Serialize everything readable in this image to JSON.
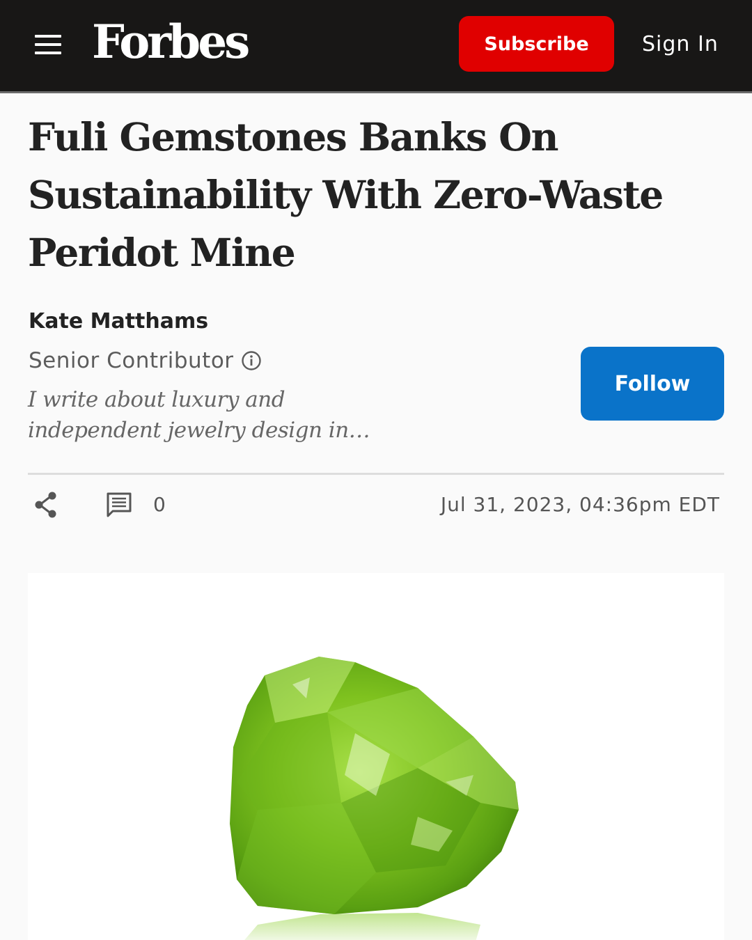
{
  "header": {
    "logo": "Forbes",
    "subscribe_label": "Subscribe",
    "signin_label": "Sign In",
    "menu_icon": "hamburger-menu-icon",
    "background_color": "#181716",
    "subscribe_color": "#e00000"
  },
  "article": {
    "title": "Fuli Gemstones Banks On Sustainability With Zero-Waste Peridot Mine",
    "author": {
      "name": "Kate Matthams",
      "role": "Senior Contributor",
      "bio": "I write about luxury and independent jewelry design in…",
      "info_icon": "info-icon",
      "follow_label": "Follow",
      "follow_color": "#0a73c9"
    },
    "meta": {
      "share_icon": "share-icon",
      "comment_icon": "comment-icon",
      "comment_count": "0",
      "published": "Jul 31, 2023,  04:36pm EDT"
    },
    "hero_image": {
      "subject": "rough green peridot gemstone",
      "color": "#7fc21f"
    }
  }
}
